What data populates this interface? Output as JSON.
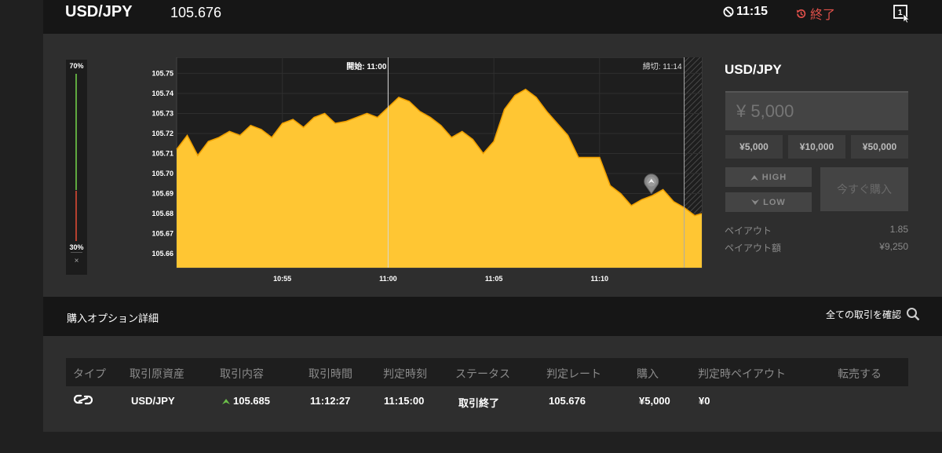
{
  "header": {
    "pair": "USD/JPY",
    "rate": "105.676",
    "timer": "11:15",
    "status": "終了",
    "icons": [
      "no-entry-icon",
      "history-icon",
      "window-pointer-icon"
    ],
    "window_icon_label": "1"
  },
  "chart": {
    "sentiment_high": "70%",
    "sentiment_low": "30%",
    "sentiment_high_value": 70,
    "sentiment_close": "×",
    "start_label": "開始: 11:00",
    "close_label": "締切: 11:14",
    "entry_marker": "up-arrow-pin-icon"
  },
  "chart_data": {
    "type": "area",
    "title": "",
    "x_ticks": [
      "10:55",
      "11:00",
      "11:05",
      "11:10"
    ],
    "y_ticks": [
      "105.75",
      "105.74",
      "105.73",
      "105.72",
      "105.71",
      "105.70",
      "105.69",
      "105.68",
      "105.67",
      "105.66"
    ],
    "ylim": [
      105.653,
      105.758
    ],
    "xlim_minutes": [
      "10:50:00",
      "11:14:50"
    ],
    "series": [
      {
        "x": [
          "10:50:00",
          "10:50:30",
          "10:51:00",
          "10:51:30",
          "10:52:00",
          "10:52:30",
          "10:53:00",
          "10:53:30",
          "10:54:00",
          "10:54:30",
          "10:55:00",
          "10:55:30",
          "10:56:00",
          "10:56:30",
          "10:57:00",
          "10:57:30",
          "10:58:00",
          "10:58:30",
          "10:59:00",
          "10:59:30",
          "11:00:00",
          "11:00:30",
          "11:01:00",
          "11:01:30",
          "11:02:00",
          "11:02:30",
          "11:03:00",
          "11:03:30",
          "11:04:00",
          "11:04:30",
          "11:05:00",
          "11:05:30",
          "11:06:00",
          "11:06:30",
          "11:07:00",
          "11:07:30",
          "11:08:00",
          "11:08:30",
          "11:09:00",
          "11:09:30",
          "11:10:00",
          "11:10:30",
          "11:11:00",
          "11:11:30",
          "11:12:00",
          "11:12:30",
          "11:13:00",
          "11:13:30",
          "11:14:00",
          "11:14:30",
          "11:14:50"
        ],
        "y": [
          105.712,
          105.719,
          105.709,
          105.716,
          105.718,
          105.721,
          105.719,
          105.724,
          105.722,
          105.718,
          105.725,
          105.727,
          105.723,
          105.728,
          105.73,
          105.725,
          105.726,
          105.728,
          105.73,
          105.728,
          105.733,
          105.738,
          105.736,
          105.731,
          105.728,
          105.724,
          105.718,
          105.721,
          105.717,
          105.71,
          105.716,
          105.732,
          105.739,
          105.742,
          105.738,
          105.731,
          105.725,
          105.719,
          105.708,
          105.708,
          105.708,
          105.694,
          105.69,
          105.684,
          105.687,
          105.689,
          105.692,
          105.686,
          105.683,
          105.679,
          105.68
        ]
      }
    ],
    "grid": true,
    "area_color": "#ffc633",
    "line_color": "#f0a000",
    "background": "#1e1e1e"
  },
  "panel": {
    "title": "USD/JPY",
    "amount_placeholder": "¥ 5,000",
    "presets": [
      "¥5,000",
      "¥10,000",
      "¥50,000"
    ],
    "high_label": "HIGH",
    "low_label": "LOW",
    "buy_label": "今すぐ購入",
    "payout_label": "ペイアウト",
    "payout_value": "1.85",
    "payout_amount_label": "ペイアウト額",
    "payout_amount_value": "¥9,250"
  },
  "options": {
    "title": "購入オプション詳細",
    "all_trades": "全ての取引を確認",
    "columns": [
      "タイプ",
      "取引原資産",
      "取引内容",
      "取引時間",
      "判定時刻",
      "ステータス",
      "判定レート",
      "購入",
      "判定時ペイアウト",
      "転売する"
    ],
    "rows": [
      {
        "type_icon": "link-chain-icon",
        "asset": "USD/JPY",
        "direction_icon": "high-arrow-icon",
        "content": "105.685",
        "trade_time": "11:12:27",
        "judge_time": "11:15:00",
        "status": "取引終了",
        "judge_rate": "105.676",
        "purchase": "¥5,000",
        "payout": "¥0",
        "resell": ""
      }
    ]
  },
  "colors": {
    "accent_area": "#ffc633",
    "high_green": "#5fa83f",
    "low_red": "#b5402f",
    "end_red": "#e0504a",
    "direction_green": "#6cc04a"
  }
}
